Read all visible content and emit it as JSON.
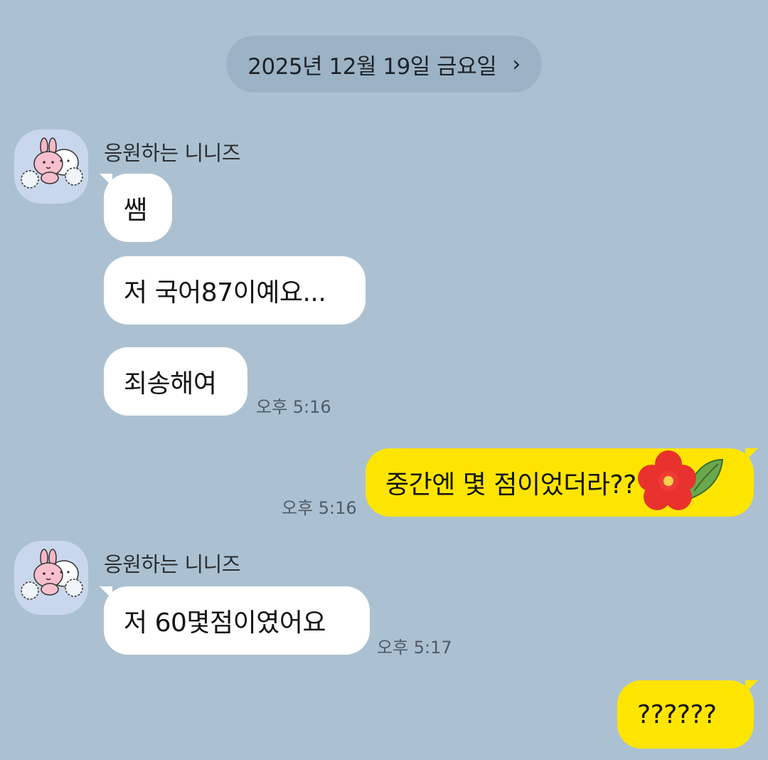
{
  "chat": {
    "date": "2025년 12월 19일 금요일",
    "date_chevron": "›",
    "messages": [
      {
        "sender": "응원하는 니니즈",
        "avatar_icon": "ninis-cheering-sticker-icon",
        "bubbles": [
          "쌤",
          "저 국어87이예요...",
          "죄송해여"
        ],
        "time": "오후 5:16"
      },
      {
        "sender": "me",
        "bubbles": [
          "중간엔 몇 점이었더라??"
        ],
        "emoji_icon": "red-flower-icon",
        "time": "오후 5:16"
      },
      {
        "sender": "응원하는 니니즈",
        "avatar_icon": "ninis-cheering-sticker-icon",
        "bubbles": [
          "저 60몇점이였어요"
        ],
        "time": "오후 5:17"
      },
      {
        "sender": "me",
        "bubbles": [
          "??????"
        ]
      }
    ]
  },
  "colors": {
    "background": "#abc1d1",
    "incoming_bubble": "#ffffff",
    "outgoing_bubble": "#fee500",
    "timestamp": "#4f5b66"
  }
}
